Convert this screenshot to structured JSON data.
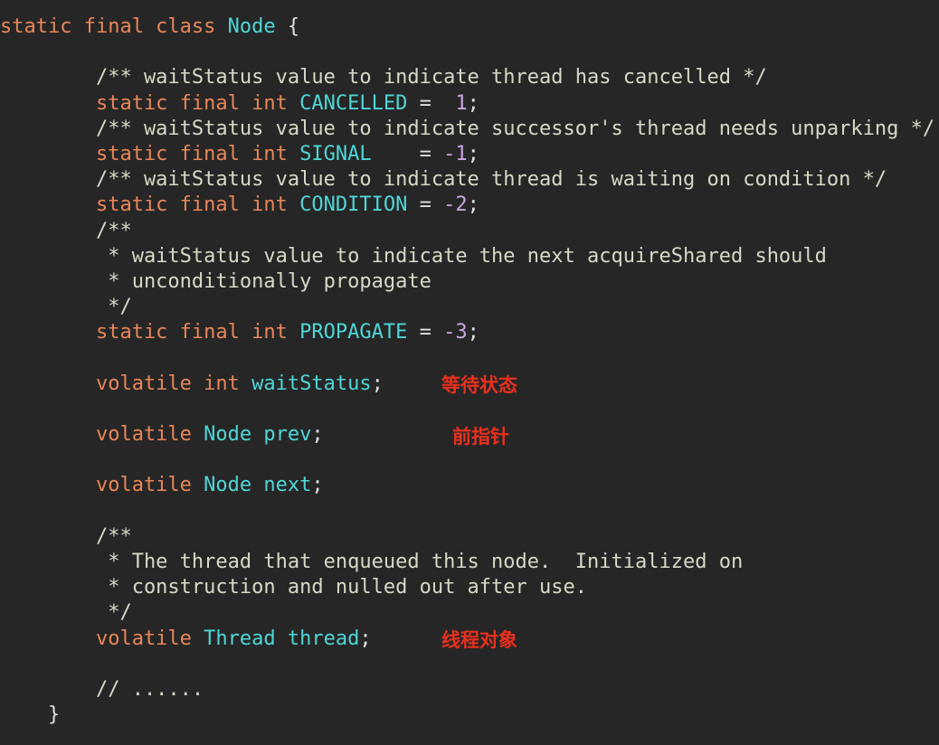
{
  "code": {
    "l1": {
      "kw": "static final class ",
      "name": "Node",
      "rest": " {"
    },
    "c1": "        /** waitStatus value to indicate thread has cancelled */",
    "d1": {
      "kw": "        static final int ",
      "name": "CANCELLED",
      "eq": " =  ",
      "num": "1",
      "end": ";"
    },
    "c2": "        /** waitStatus value to indicate successor's thread needs unparking */",
    "d2": {
      "kw": "        static final int ",
      "name": "SIGNAL",
      "eq": "    = ",
      "num": "-1",
      "end": ";"
    },
    "c3": "        /** waitStatus value to indicate thread is waiting on condition */",
    "d3": {
      "kw": "        static final int ",
      "name": "CONDITION",
      "eq": " = ",
      "num": "-2",
      "end": ";"
    },
    "c4a": "        /**",
    "c4b": "         * waitStatus value to indicate the next acquireShared should",
    "c4c": "         * unconditionally propagate",
    "c4d": "         */",
    "d4": {
      "kw": "        static final int ",
      "name": "PROPAGATE",
      "eq": " = ",
      "num": "-3",
      "end": ";"
    },
    "f1": {
      "kw": "        volatile ",
      "type": "int",
      "sp": " ",
      "name": "waitStatus",
      "end": ";"
    },
    "f2": {
      "kw": "        volatile ",
      "type": "Node",
      "sp": " ",
      "name": "prev",
      "end": ";"
    },
    "f3": {
      "kw": "        volatile ",
      "type": "Node",
      "sp": " ",
      "name": "next",
      "end": ";"
    },
    "c5a": "        /**",
    "c5b": "         * The thread that enqueued this node.  Initialized on",
    "c5c": "         * construction and nulled out after use.",
    "c5d": "         */",
    "f4": {
      "kw": "        volatile ",
      "type": "Thread",
      "sp": " ",
      "name": "thread",
      "end": ";"
    },
    "c6": "        // ......",
    "close": "    }"
  },
  "annotations": {
    "wait_status": "等待状态",
    "prev_pointer": "前指针",
    "thread_object": "线程对象"
  },
  "colors": {
    "background": "#262626",
    "keyword": "#e8865a",
    "identifier": "#4fd6d6",
    "comment": "#d8d8c8",
    "number": "#c9a6e0",
    "annotation": "#e8301e"
  }
}
